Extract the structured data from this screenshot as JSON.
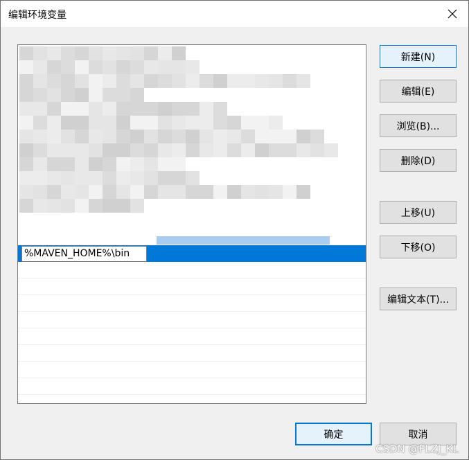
{
  "window": {
    "title": "编辑环境变量",
    "close_icon": "close-icon"
  },
  "list": {
    "editing_value": "%MAVEN_HOME%\\bin"
  },
  "buttons": {
    "new": "新建(N)",
    "edit": "编辑(E)",
    "browse": "浏览(B)...",
    "delete": "删除(D)",
    "move_up": "上移(U)",
    "move_down": "下移(O)",
    "edit_text": "编辑文本(T)...",
    "ok": "确定",
    "cancel": "取消"
  },
  "watermark": "CSDN @FLZJ_KL",
  "colors": {
    "selection": "#0078d7",
    "button_face": "#e1e1e1",
    "focus_border": "#0078d7"
  }
}
